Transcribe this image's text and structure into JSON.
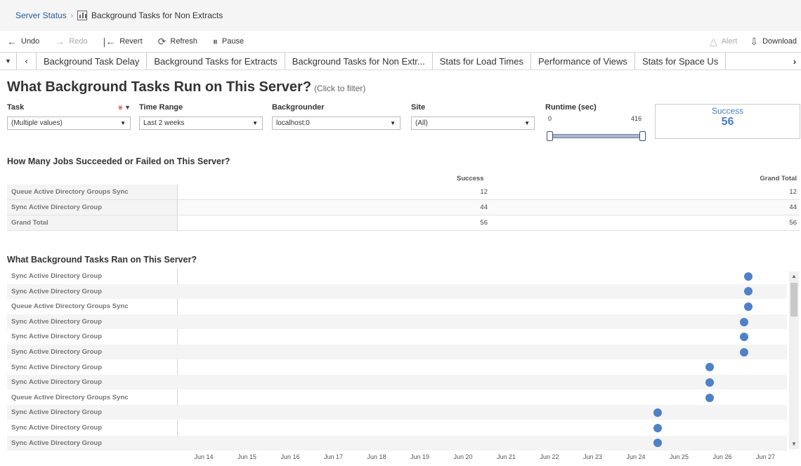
{
  "breadcrumb": {
    "parent": "Server Status",
    "current": "Background Tasks for Non Extracts"
  },
  "toolbar": {
    "undo": "Undo",
    "redo": "Redo",
    "revert": "Revert",
    "refresh": "Refresh",
    "pause": "Pause",
    "alert": "Alert",
    "download": "Download"
  },
  "tabs": [
    "Background Task Delay",
    "Background Tasks for Extracts",
    "Background Tasks for Non Extr...",
    "Stats for Load Times",
    "Performance of Views",
    "Stats for Space Us"
  ],
  "dashboard": {
    "title": "What Background Tasks Run on This Server?",
    "title_hint": "(Click to filter)"
  },
  "filters": {
    "task": {
      "label": "Task",
      "value": "(Multiple values)"
    },
    "time_range": {
      "label": "Time Range",
      "value": "Last 2 weeks"
    },
    "backgrounder": {
      "label": "Backgrounder",
      "value": "localhost:0"
    },
    "site": {
      "label": "Site",
      "value": "(All)"
    },
    "runtime": {
      "label": "Runtime (sec)",
      "min": "0",
      "max": "416"
    }
  },
  "kpi": {
    "label": "Success",
    "value": "56"
  },
  "summary": {
    "title": "How Many Jobs Succeeded or Failed on This Server?",
    "columns": [
      "Success",
      "Grand Total"
    ],
    "rows": [
      {
        "name": "Queue Active Directory Groups Sync",
        "success": "12",
        "total": "12"
      },
      {
        "name": "Sync Active Directory Group",
        "success": "44",
        "total": "44"
      },
      {
        "name": "Grand Total",
        "success": "56",
        "total": "56"
      }
    ]
  },
  "chart_data": {
    "type": "scatter",
    "title": "What Background Tasks Ran on This Server?",
    "x_ticks": [
      "Jun 14",
      "Jun 15",
      "Jun 16",
      "Jun 17",
      "Jun 18",
      "Jun 19",
      "Jun 20",
      "Jun 21",
      "Jun 22",
      "Jun 23",
      "Jun 24",
      "Jun 25",
      "Jun 26",
      "Jun 27"
    ],
    "xlim_days": [
      "Jun 14",
      "Jun 27"
    ],
    "rows": [
      {
        "task": "Sync Active Directory Group",
        "date": "Jun 26.6"
      },
      {
        "task": "Sync Active Directory Group",
        "date": "Jun 26.6"
      },
      {
        "task": "Queue Active Directory Groups Sync",
        "date": "Jun 26.6"
      },
      {
        "task": "Sync Active Directory Group",
        "date": "Jun 26.5"
      },
      {
        "task": "Sync Active Directory Group",
        "date": "Jun 26.5"
      },
      {
        "task": "Sync Active Directory Group",
        "date": "Jun 26.5"
      },
      {
        "task": "Sync Active Directory Group",
        "date": "Jun 25.7"
      },
      {
        "task": "Sync Active Directory Group",
        "date": "Jun 25.7"
      },
      {
        "task": "Queue Active Directory Groups Sync",
        "date": "Jun 25.7"
      },
      {
        "task": "Sync Active Directory Group",
        "date": "Jun 24.5"
      },
      {
        "task": "Sync Active Directory Group",
        "date": "Jun 24.5"
      },
      {
        "task": "Sync Active Directory Group",
        "date": "Jun 24.5"
      }
    ]
  },
  "colors": {
    "accent": "#4f81c7",
    "link": "#1f5c99"
  }
}
